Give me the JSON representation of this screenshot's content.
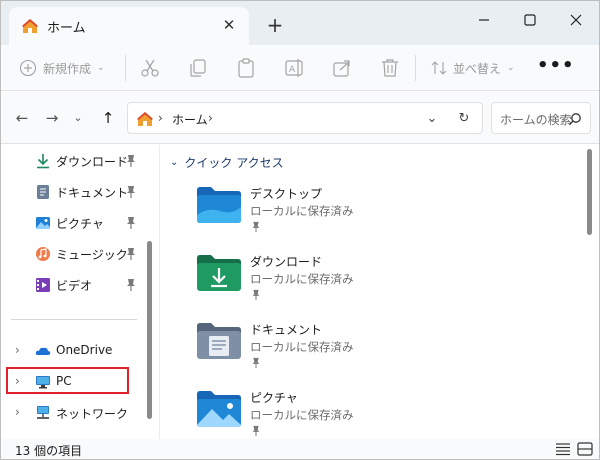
{
  "tab": {
    "title": "ホーム"
  },
  "toolbar": {
    "new_label": "新規作成",
    "sort_label": "並べ替え",
    "more_label": "•••"
  },
  "address": {
    "crumb": "ホーム"
  },
  "search": {
    "placeholder": "ホームの検索"
  },
  "sidebar": {
    "pinned": [
      {
        "label": "ダウンロード",
        "icon": "download-icon"
      },
      {
        "label": "ドキュメント",
        "icon": "documents-icon"
      },
      {
        "label": "ピクチャ",
        "icon": "pictures-icon"
      },
      {
        "label": "ミュージック",
        "icon": "music-icon"
      },
      {
        "label": "ビデオ",
        "icon": "videos-icon"
      }
    ],
    "tree": [
      {
        "label": "OneDrive",
        "icon": "cloud-icon"
      },
      {
        "label": "PC",
        "icon": "monitor-icon"
      },
      {
        "label": "ネットワーク",
        "icon": "network-icon"
      }
    ]
  },
  "content": {
    "section_title": "クイック アクセス",
    "folders": [
      {
        "name": "デスクトップ",
        "subtitle": "ローカルに保存済み",
        "icon": "desktop-folder-icon"
      },
      {
        "name": "ダウンロード",
        "subtitle": "ローカルに保存済み",
        "icon": "download-folder-icon"
      },
      {
        "name": "ドキュメント",
        "subtitle": "ローカルに保存済み",
        "icon": "documents-folder-icon"
      },
      {
        "name": "ピクチャ",
        "subtitle": "ローカルに保存済み",
        "icon": "pictures-folder-icon"
      }
    ]
  },
  "status": {
    "item_count": "13 個の項目"
  },
  "colors": {
    "accent": "#0067c0",
    "highlight_box": "#e0202a",
    "titlebar_bg": "#e9eef3"
  }
}
